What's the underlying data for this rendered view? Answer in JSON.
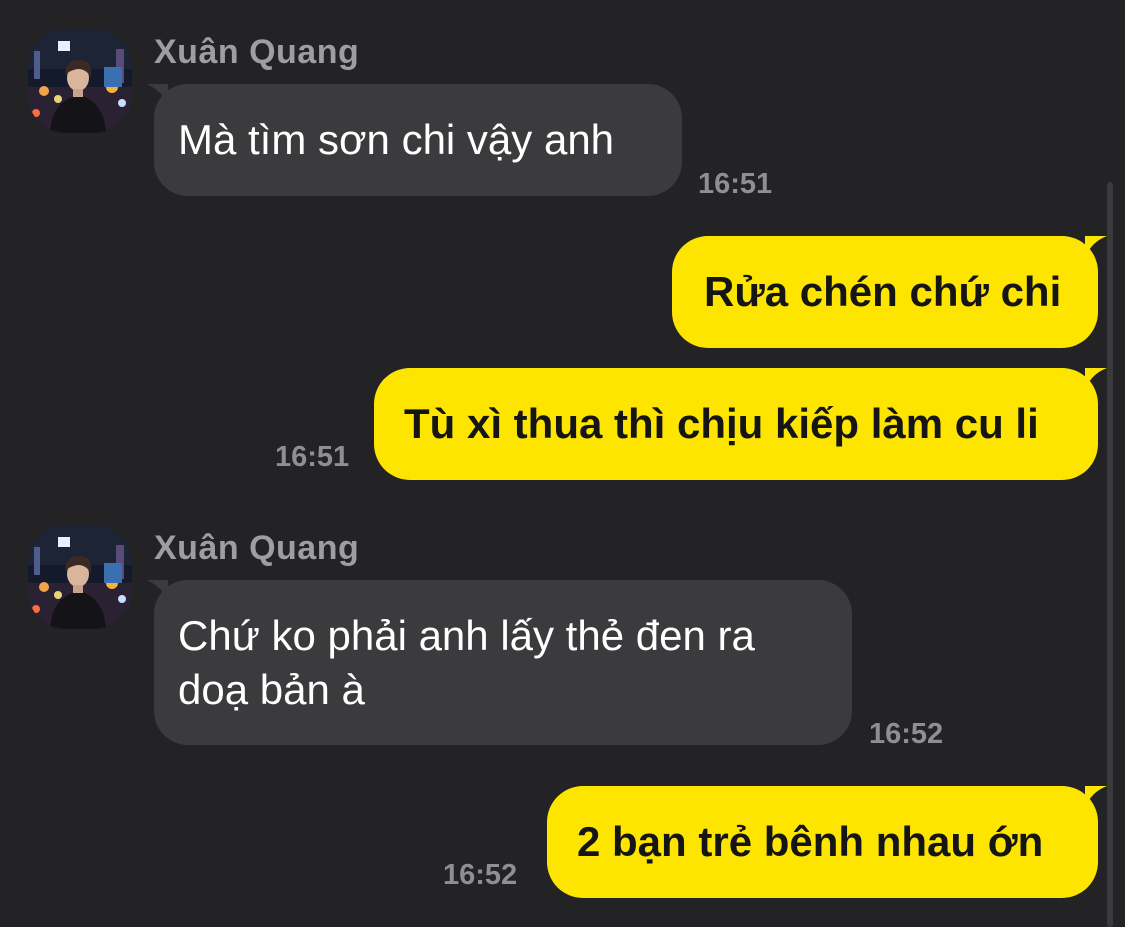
{
  "chat": {
    "messages": [
      {
        "direction": "incoming",
        "sender": "Xuân Quang",
        "lines": [
          "Mà tìm sơn chi vậy anh"
        ],
        "time": "16:51"
      },
      {
        "direction": "outgoing",
        "lines": [
          "Rửa chén chứ chi"
        ],
        "time": ""
      },
      {
        "direction": "outgoing",
        "lines": [
          "Tù xì thua thì chịu kiếp làm cu li"
        ],
        "time": "16:51"
      },
      {
        "direction": "incoming",
        "sender": "Xuân Quang",
        "lines": [
          "Chứ ko phải anh lấy thẻ đen ra",
          "doạ bản à"
        ],
        "time": "16:52"
      },
      {
        "direction": "outgoing",
        "lines": [
          "2 bạn trẻ bênh nhau ớn"
        ],
        "time": "16:52"
      }
    ]
  },
  "colors": {
    "background": "#232325",
    "incoming_bubble": "#3b3b3e",
    "outgoing_bubble": "#fde500",
    "timestamp": "#8e8e93",
    "sender_name": "#9d9da2"
  }
}
